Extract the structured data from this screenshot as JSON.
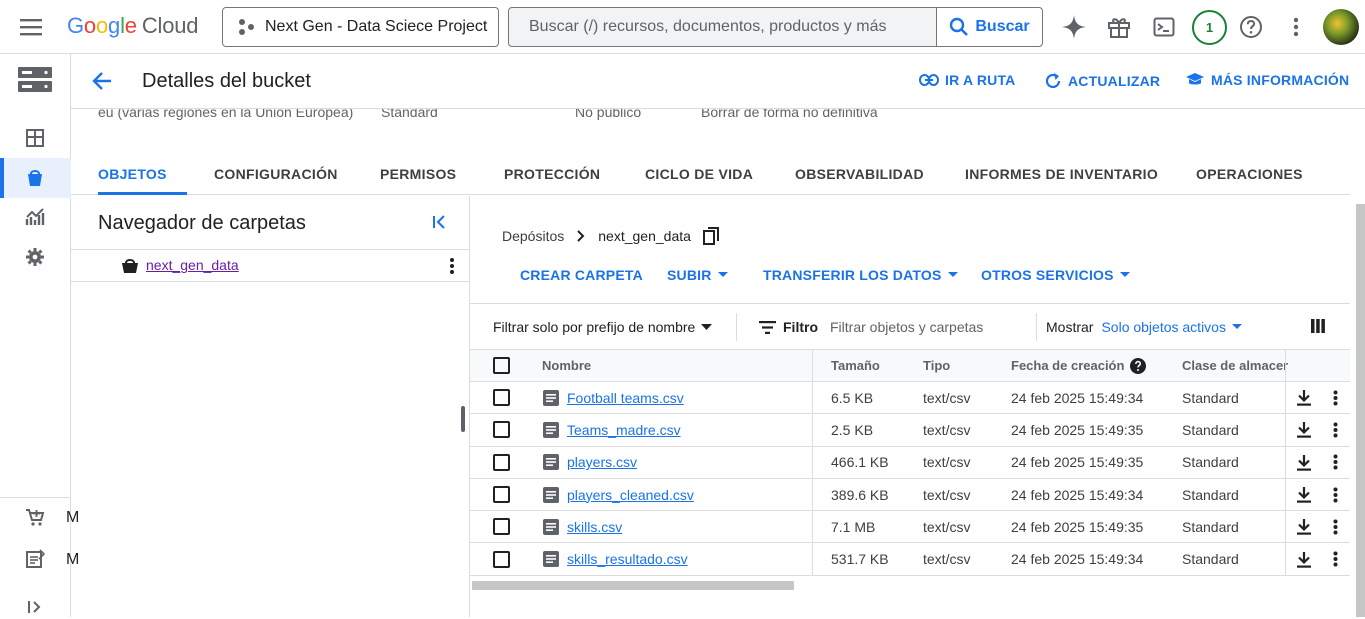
{
  "topbar": {
    "logo_google": "Google",
    "logo_cloud": "Cloud",
    "project": "Next Gen - Data Sciece Project",
    "search_placeholder": "Buscar (/) recursos, documentos, productos y más",
    "search_button": "Buscar",
    "notification_count": "1",
    "icons": [
      "menu-icon",
      "gemini-icon",
      "gift-icon",
      "cloud-shell-icon",
      "help-icon",
      "more-vert-icon"
    ]
  },
  "rail": {
    "icons": [
      "storage-icon",
      "dashboard-icon",
      "bucket-icon",
      "monitoring-icon",
      "settings-icon",
      "marketplace-icon",
      "release-notes-icon",
      "expand-icon"
    ],
    "bottom_labels": [
      "M",
      "M"
    ]
  },
  "header": {
    "title": "Detalles del bucket",
    "links": [
      "IR A RUTA",
      "ACTUALIZAR",
      "MÁS INFORMACIÓN"
    ]
  },
  "info_row": {
    "location": "eu (varias regiones en la Unión Europea)",
    "storage_class": "Standard",
    "public_access": "No público",
    "protection": "Borrar de forma no definitiva"
  },
  "tabs": [
    "OBJETOS",
    "CONFIGURACIÓN",
    "PERMISOS",
    "PROTECCIÓN",
    "CICLO DE VIDA",
    "OBSERVABILIDAD",
    "INFORMES DE INVENTARIO",
    "OPERACIONES"
  ],
  "folder_browser": {
    "title": "Navegador de carpetas",
    "root": "next_gen_data"
  },
  "breadcrumb": {
    "root": "Depósitos",
    "current": "next_gen_data"
  },
  "actions": [
    "CREAR CARPETA",
    "SUBIR",
    "TRANSFERIR LOS DATOS",
    "OTROS SERVICIOS"
  ],
  "filter": {
    "prefix_label": "Filtrar solo por prefijo de nombre",
    "filter_label": "Filtro",
    "input_placeholder": "Filtrar objetos y carpetas",
    "show_label": "Mostrar",
    "show_value": "Solo objetos activos"
  },
  "table": {
    "columns": [
      "Nombre",
      "Tamaño",
      "Tipo",
      "Fecha de creación",
      "Clase de almacer"
    ],
    "rows": [
      {
        "name": "Football teams.csv",
        "size": "6.5 KB",
        "type": "text/csv",
        "created": "24 feb 2025 15:49:34",
        "class": "Standard"
      },
      {
        "name": "Teams_madre.csv",
        "size": "2.5 KB",
        "type": "text/csv",
        "created": "24 feb 2025 15:49:35",
        "class": "Standard"
      },
      {
        "name": "players.csv",
        "size": "466.1 KB",
        "type": "text/csv",
        "created": "24 feb 2025 15:49:35",
        "class": "Standard"
      },
      {
        "name": "players_cleaned.csv",
        "size": "389.6 KB",
        "type": "text/csv",
        "created": "24 feb 2025 15:49:34",
        "class": "Standard"
      },
      {
        "name": "skills.csv",
        "size": "7.1 MB",
        "type": "text/csv",
        "created": "24 feb 2025 15:49:35",
        "class": "Standard"
      },
      {
        "name": "skills_resultado.csv",
        "size": "531.7 KB",
        "type": "text/csv",
        "created": "24 feb 2025 15:49:34",
        "class": "Standard"
      }
    ]
  },
  "colors": {
    "accent": "#1a73e8",
    "visited_link": "#681da8",
    "badge": "#188038"
  }
}
